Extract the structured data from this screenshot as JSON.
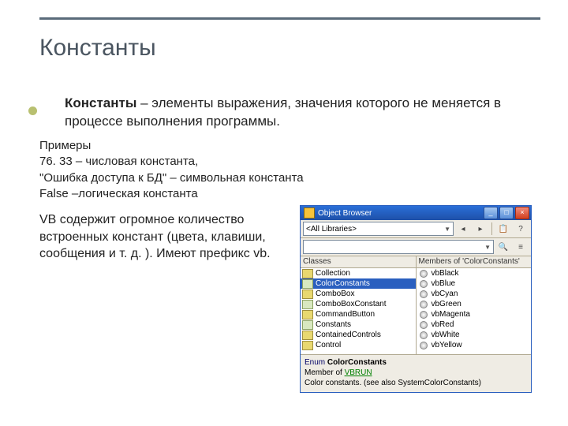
{
  "title": "Константы",
  "definition_term": "Константы",
  "definition_rest": " – элементы выражения, значения которого не меняется в процессе выполнения программы.",
  "examples_heading": "Примеры",
  "ex1": "76. 33 – числовая константа,",
  "ex2": "\"Ошибка доступа к БД\" – символьная константа",
  "ex3": "False –логическая константа",
  "paragraph": "VB содержит огромное количество встроенных констант (цвета, клавиши, сообщения и т. д. ). Имеют префикс vb.",
  "object_browser": {
    "window_title": "Object Browser",
    "library_selector": "<All Libraries>",
    "classes_header": "Classes",
    "members_header": "Members of 'ColorConstants'",
    "classes": [
      {
        "label": "Collection",
        "icon": "class"
      },
      {
        "label": "ColorConstants",
        "icon": "enum",
        "selected": true
      },
      {
        "label": "ComboBox",
        "icon": "class"
      },
      {
        "label": "ComboBoxConstant",
        "icon": "enum"
      },
      {
        "label": "CommandButton",
        "icon": "class"
      },
      {
        "label": "Constants",
        "icon": "enum"
      },
      {
        "label": "ContainedControls",
        "icon": "class"
      },
      {
        "label": "Control",
        "icon": "class"
      }
    ],
    "members": [
      {
        "label": "vbBlack"
      },
      {
        "label": "vbBlue"
      },
      {
        "label": "vbCyan"
      },
      {
        "label": "vbGreen"
      },
      {
        "label": "vbMagenta"
      },
      {
        "label": "vbRed"
      },
      {
        "label": "vbWhite"
      },
      {
        "label": "vbYellow"
      }
    ],
    "detail_kw": "Enum",
    "detail_name": "ColorConstants",
    "detail_line2a": "Member of ",
    "detail_line2b": "VBRUN",
    "detail_line3": "Color constants. (see also SystemColorConstants)"
  }
}
